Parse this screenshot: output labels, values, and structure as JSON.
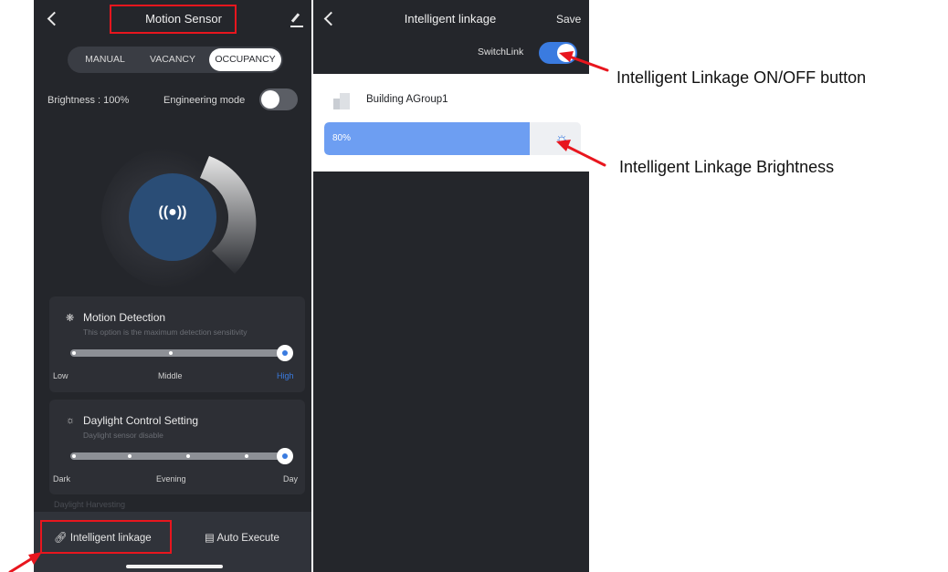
{
  "left_screen": {
    "title": "Motion Sensor",
    "modes": [
      "MANUAL",
      "VACANCY",
      "OCCUPANCY"
    ],
    "active_mode": "OCCUPANCY",
    "brightness_label": "Brightness : 100%",
    "engineering_mode_label": "Engineering mode",
    "engineering_mode_on": false,
    "dial_icon": "((●))",
    "motion_card": {
      "title": "Motion Detection",
      "subtitle": "This option is the maximum detection sensitivity",
      "scale": [
        "Low",
        "Middle",
        "High"
      ],
      "selected": "High"
    },
    "daylight_card": {
      "title": "Daylight Control Setting",
      "subtitle": "Daylight sensor disable",
      "scale": [
        "Dark",
        "Evening",
        "Day"
      ],
      "selected": "Day"
    },
    "faded_text": "Daylight Harvesting",
    "bottom_tabs": {
      "intelligent_linkage": "Intelligent linkage",
      "auto_execute": "Auto Execute"
    }
  },
  "right_screen": {
    "title": "Intelligent linkage",
    "save_label": "Save",
    "switchlink_label": "SwitchLink",
    "switchlink_on": true,
    "group_name": "Building AGroup1",
    "brightness_text": "80%",
    "brightness_percent": 80
  },
  "annotations": {
    "onoff_button": "Intelligent Linkage ON/OFF button",
    "brightness": "Intelligent Linkage Brightness"
  },
  "colors": {
    "background_dark": "#24262b",
    "accent_blue": "#3a7be0",
    "brightness_fill": "#6d9ef2",
    "callout_red": "#e8161e",
    "dial_blue": "#2a4d76"
  }
}
